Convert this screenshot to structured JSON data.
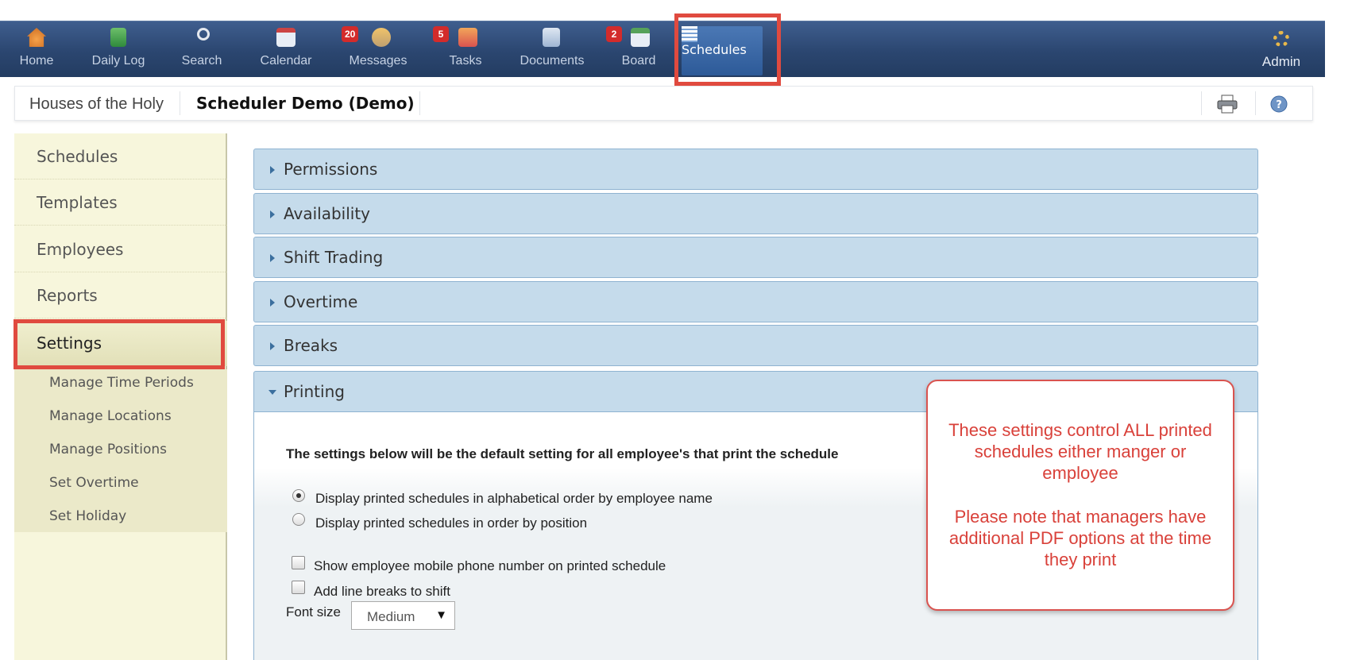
{
  "nav": {
    "items": [
      {
        "label": "Home",
        "icon": "home-icon",
        "badge": ""
      },
      {
        "label": "Daily Log",
        "icon": "daily-log-icon",
        "badge": ""
      },
      {
        "label": "Search",
        "icon": "search-icon",
        "badge": ""
      },
      {
        "label": "Calendar",
        "icon": "calendar-icon",
        "badge": ""
      },
      {
        "label": "Messages",
        "icon": "messages-icon",
        "badge": "20"
      },
      {
        "label": "Tasks",
        "icon": "tasks-icon",
        "badge": "5"
      },
      {
        "label": "Documents",
        "icon": "documents-icon",
        "badge": ""
      },
      {
        "label": "Board",
        "icon": "board-icon",
        "badge": "2"
      }
    ],
    "active": {
      "label": "Schedules",
      "icon": "schedules-icon"
    },
    "admin": {
      "label": "Admin",
      "icon": "gear-icon"
    }
  },
  "subheader": {
    "location": "Houses of the Holy",
    "title": "Scheduler Demo (Demo)"
  },
  "sidebar": {
    "items": [
      "Schedules",
      "Templates",
      "Employees",
      "Reports",
      "Settings"
    ],
    "active": "Settings",
    "subitems": [
      "Manage Time Periods",
      "Manage Locations",
      "Manage Positions",
      "Set Overtime",
      "Set Holiday"
    ]
  },
  "accordion": {
    "sections": [
      "Permissions",
      "Availability",
      "Shift Trading",
      "Overtime",
      "Breaks"
    ],
    "open_section": "Printing"
  },
  "printing": {
    "intro": "The settings below will be the default setting for all employee's that print the schedule",
    "order_options": [
      {
        "label": "Display printed schedules in alphabetical order by employee name",
        "selected": true
      },
      {
        "label": "Display printed schedules in order by position",
        "selected": false
      }
    ],
    "checkboxes": [
      {
        "label": "Show employee mobile phone number on printed schedule",
        "checked": false
      },
      {
        "label": "Add line breaks to shift",
        "checked": false
      }
    ],
    "font_size_label": "Font size",
    "font_size_value": "Medium"
  },
  "callout": {
    "line1": "These settings control ALL printed schedules either manger or employee",
    "line2": "Please note that managers have additional PDF options at the time they print"
  },
  "colors": {
    "highlight": "#e04a3f",
    "nav_bg": "#2b4670",
    "accordion_bg": "#c5dbeb",
    "sidebar_bg": "#f7f6dc",
    "callout_text": "#d9413a"
  }
}
